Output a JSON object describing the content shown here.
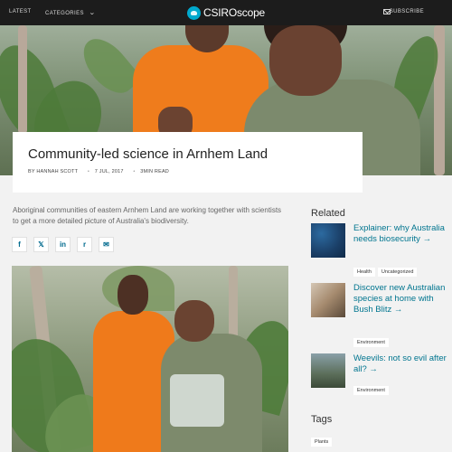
{
  "nav": {
    "latest": "LATEST",
    "categories": "CATEGORIES",
    "brand": "CSIROscope",
    "subscribe": "SUBSCRIBE"
  },
  "article": {
    "title": "Community-led science in Arnhem Land",
    "author": "BY HANNAH SCOTT",
    "date": "7 JUL, 2017",
    "read_time": "3MIN READ",
    "intro": "Aboriginal communities of eastern Arnhem Land are working together with scientists to get a more detailed picture of Australia's biodiversity."
  },
  "share": {
    "facebook": "f",
    "x": "𝕏",
    "linkedin": "in",
    "reddit": "r",
    "email": "✉"
  },
  "sidebar": {
    "related_heading": "Related",
    "items": [
      {
        "title": "Explainer: why Australia needs biosecurity →",
        "tags": [
          "Health",
          "Uncategorized"
        ],
        "thumb_icon": "microscope-image"
      },
      {
        "title": "Discover new Australian species at home with Bush Blitz →",
        "tags": [
          "Environment"
        ],
        "thumb_icon": "insect-image"
      },
      {
        "title": "Weevils: not so evil after all? →",
        "tags": [
          "Environment"
        ],
        "thumb_icon": "researcher-image"
      }
    ],
    "tags_heading": "Tags",
    "tags": [
      "Plants"
    ]
  },
  "colors": {
    "topbar": "#1c1c1c",
    "link": "#00758f",
    "brand_logo": "#00a9ce",
    "orange_shirt": "#ef7c1c"
  }
}
